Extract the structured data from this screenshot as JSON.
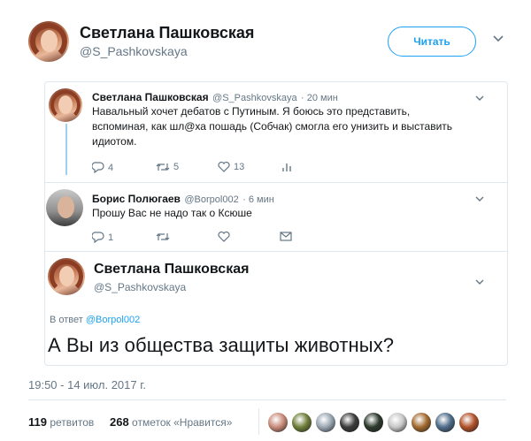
{
  "header": {
    "name": "Светлана Пашковская",
    "handle": "@S_Pashkovskaya",
    "follow_label": "Читать",
    "menu_glyph": "⌄"
  },
  "thread": [
    {
      "name": "Светлана Пашковская",
      "handle": "@S_Pashkovskaya",
      "time": "· 20 мин",
      "text_lines": [
        "Навальный хочет дебатов с Путиным. Я боюсь это представить,",
        "вспоминая, как шл@ха пошадь (Собчак) смогла его унизить и выставить",
        "идиотом."
      ],
      "replies": "4",
      "retweets": "5",
      "likes": "13"
    },
    {
      "name": "Борис Полюгаев",
      "handle": "@Borpol002",
      "time": "· 6 мин",
      "text_lines": [
        "Прошу Вас не надо так о Ксюше"
      ],
      "replies": "1",
      "retweets": "",
      "likes": ""
    }
  ],
  "main_tweet": {
    "name": "Светлана Пашковская",
    "handle": "@S_Pashkovskaya",
    "reply_prefix": "В ответ",
    "reply_handle": "@Borpol002",
    "text": "А Вы из общества защиты животных?"
  },
  "footer": {
    "timestamp": "19:50 - 14 июл. 2017 г.",
    "retweets_count": "119",
    "retweets_label": "ретвитов",
    "likes_count": "268",
    "likes_label": "отметок «Нравится»"
  },
  "likers_colors": [
    "#c98b7a",
    "#6f7f3a",
    "#9aa7b3",
    "#3b3b3b",
    "#2d3a2d",
    "#c7c7c7",
    "#a36a2f",
    "#4f6d8a",
    "#b0522a"
  ],
  "colors": {
    "accent": "#1da1f2",
    "text": "#14171a",
    "muted": "#657786",
    "border": "#e1e8ed"
  }
}
